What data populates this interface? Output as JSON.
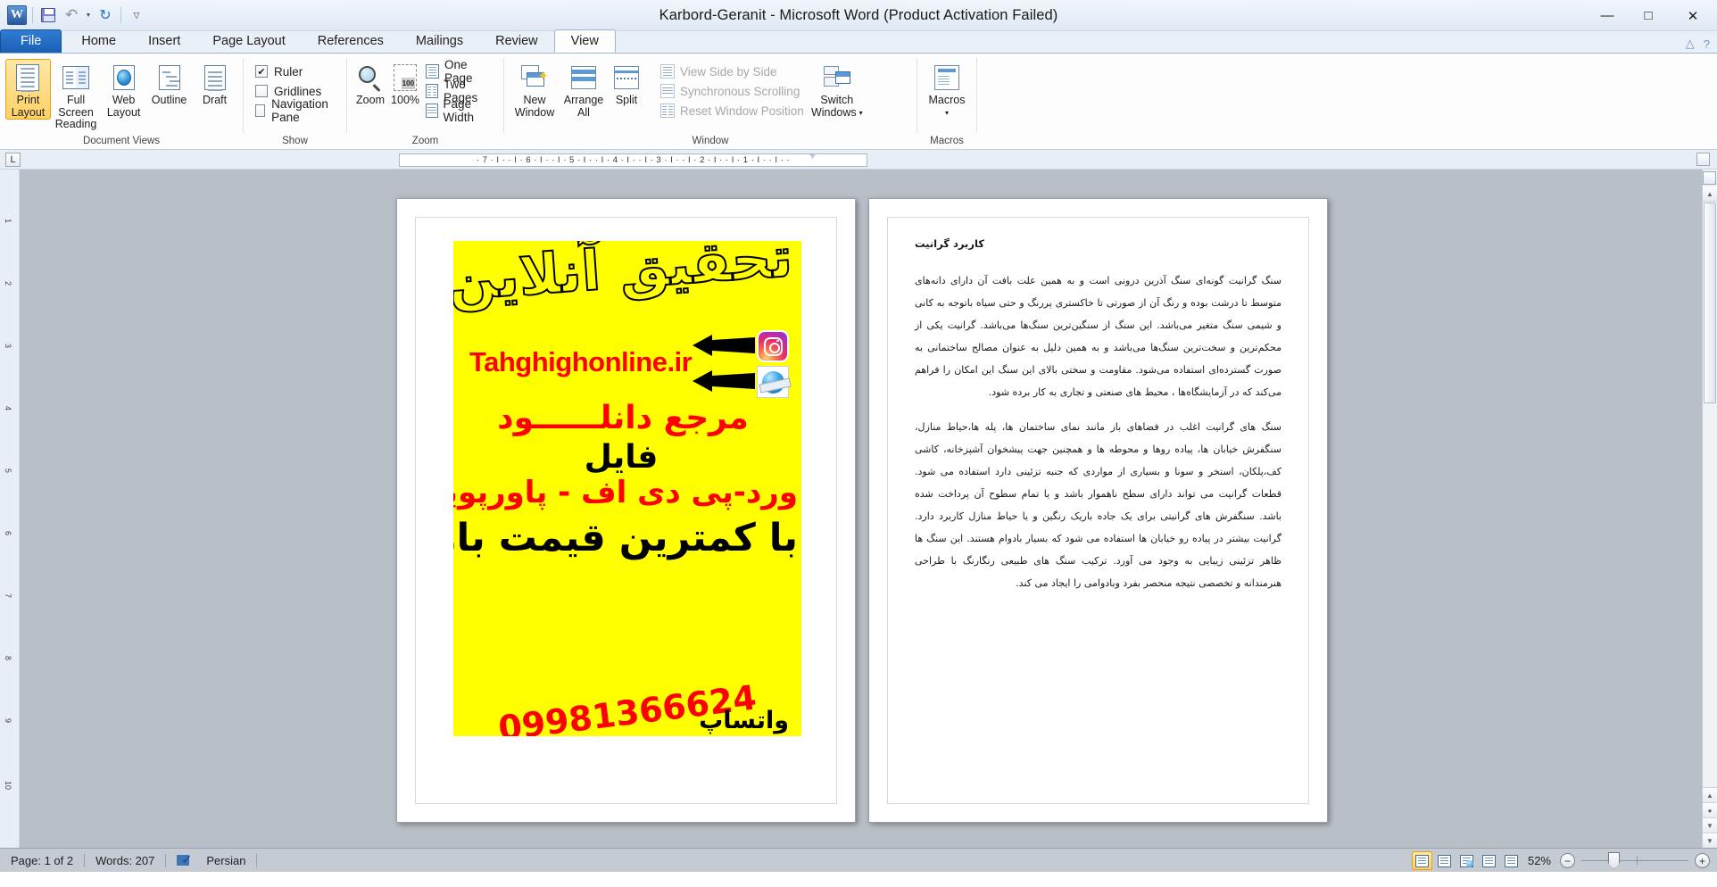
{
  "titlebar": {
    "title": "Karbord-Geranit  -  Microsoft Word (Product Activation Failed)",
    "word_logo": "W",
    "qat": [
      {
        "name": "save-icon",
        "label": "Save"
      },
      {
        "name": "undo-icon",
        "label": "Undo"
      },
      {
        "name": "redo-icon",
        "label": "Redo"
      },
      {
        "name": "customize-qat-icon",
        "label": "Customize Quick Access Toolbar"
      }
    ],
    "minimize": "—",
    "maximize": "□",
    "close": "✕"
  },
  "tabs": [
    {
      "label": "File",
      "active": false,
      "file": true
    },
    {
      "label": "Home",
      "active": false
    },
    {
      "label": "Insert",
      "active": false
    },
    {
      "label": "Page Layout",
      "active": false
    },
    {
      "label": "References",
      "active": false
    },
    {
      "label": "Mailings",
      "active": false
    },
    {
      "label": "Review",
      "active": false
    },
    {
      "label": "View",
      "active": true
    }
  ],
  "tab_help": {
    "minimize_ribbon": "△",
    "help": "?"
  },
  "ribbon": {
    "groups": [
      {
        "label": "Document Views",
        "buttons": [
          {
            "label_line1": "Print",
            "label_line2": "Layout",
            "icon": "print-layout-icon",
            "selected": true
          },
          {
            "label_line1": "Full Screen",
            "label_line2": "Reading",
            "icon": "full-screen-reading-icon",
            "selected": false
          },
          {
            "label_line1": "Web",
            "label_line2": "Layout",
            "icon": "web-layout-icon",
            "selected": false
          },
          {
            "label_line1": "Outline",
            "label_line2": "",
            "icon": "outline-icon",
            "selected": false
          },
          {
            "label_line1": "Draft",
            "label_line2": "",
            "icon": "draft-icon",
            "selected": false
          }
        ]
      },
      {
        "label": "Show",
        "checkboxes": [
          {
            "label": "Ruler",
            "checked": true,
            "mark": "✔"
          },
          {
            "label": "Gridlines",
            "checked": false,
            "mark": ""
          },
          {
            "label": "Navigation Pane",
            "checked": false,
            "mark": ""
          }
        ]
      },
      {
        "label": "Zoom",
        "buttons": [
          {
            "label_line1": "Zoom",
            "label_line2": "",
            "icon": "magnifier-icon"
          },
          {
            "label_line1": "100%",
            "label_line2": "",
            "icon": "zoom-100-icon",
            "badge": "100"
          }
        ],
        "small_buttons": [
          {
            "label": "One Page",
            "icon": "one-page-icon",
            "disabled": false
          },
          {
            "label": "Two Pages",
            "icon": "two-pages-icon",
            "disabled": false
          },
          {
            "label": "Page Width",
            "icon": "page-width-icon",
            "disabled": false
          }
        ]
      },
      {
        "label": "Window",
        "buttons": [
          {
            "label_line1": "New",
            "label_line2": "Window",
            "icon": "new-window-icon"
          },
          {
            "label_line1": "Arrange",
            "label_line2": "All",
            "icon": "arrange-all-icon"
          },
          {
            "label_line1": "Split",
            "label_line2": "",
            "icon": "split-icon"
          }
        ],
        "small_buttons": [
          {
            "label": "View Side by Side",
            "icon": "view-side-by-side-icon",
            "disabled": true
          },
          {
            "label": "Synchronous Scrolling",
            "icon": "synchronous-scrolling-icon",
            "disabled": true
          },
          {
            "label": "Reset Window Position",
            "icon": "reset-window-position-icon",
            "disabled": true
          }
        ],
        "switch_windows": {
          "label_line1": "Switch",
          "label_line2": "Windows",
          "icon": "switch-windows-icon",
          "arrow": "▾"
        }
      },
      {
        "label": "Macros",
        "buttons": [
          {
            "label_line1": "Macros",
            "label_line2": "",
            "icon": "macros-icon",
            "arrow": "▾"
          }
        ]
      }
    ]
  },
  "ruler": {
    "tab_selector": "L",
    "marks": "· 7 · I · · I · 6 · I · · I · 5 · I · · I · 4 · I · · I · 3 · I · · I · 2 · I · · I · 1 · I · · I · ·"
  },
  "vertical_ruler": {
    "marks": [
      "1",
      "2",
      "3",
      "4",
      "5",
      "6",
      "7",
      "8",
      "9",
      "10"
    ]
  },
  "document": {
    "page1": {
      "ad": {
        "headline": "تحقیق آنلاین",
        "url": "Tahghighonline.ir",
        "line_red1": "مرجع دانلــــــود",
        "line_black1": "فایل",
        "line_red2": "ورد-پی دی اف - پاورپوینت",
        "line_black2": "با کمترین قیمت بازار",
        "phone": "09981366624",
        "whatsapp": "واتساپ",
        "bg_color": "#ffff00",
        "accent_color": "#ff0000"
      }
    },
    "page2": {
      "heading": "کاربرد گرانیت",
      "paragraphs": [
        "سنگ گرانیت گونه‌ای سنگ آذرین درونی است و به همین علت بافت آن دارای دانه‌های متوسط تا درشت بوده و رنگ آن از صورتی تا خاکستری پررنگ و حتی سیاه باتوجه به کانی و شیمی سنگ متغیر می‌باشد. این سنگ از سنگین‌ترین سنگ‌ها می‌باشد. گرانیت یکی از محکم‌ترین و سخت‌ترین سنگ‌ها می‌باشد و به همین دلیل به عنوان مصالح ساختمانی به صورت گسترده‌ای استفاده می‌شود. مقاومت و سختی بالای این سنگ این امکان را فراهم می‌کند که در آزمایشگاه‌ها ، محیط های صنعتی و تجاری به کار برده شود.",
        "سنگ های گرانیت اغلب در فضاهای باز مانند نمای ساختمان ها، پله ها،حیاط منازل، سنگفرش خیابان ها، پیاده روها و محوطه ها و همچنین جهت پیشخوان آشپزخانه، کاشی کف،پلکان، استخر و سونا و بسیاری از مواردی که جنبه تزئینی دارد استفاده می شود. قطعات گرانیت می تواند دارای سطح ناهموار باشد و یا تمام سطوح آن پرداخت شده باشد. سنگفرش های گرانیتی برای یک جاده باریک رنگین و یا حیاط منازل کاربرد دارد. گرانیت بیشتر در پیاده رو خیابان ها استفاده می شود که بسیار بادوام هستند. این سنگ ها ظاهر تزئینی زیبایی به وجود می آورد. ترکیب سنگ های طبیعی رنگارنگ با طراحی هنرمندانه و تخصصی نتیجه منحصر بفرد وبادوامی را ایجاد می کند."
      ]
    }
  },
  "status_bar": {
    "page": "Page: 1 of 2",
    "words": "Words: 207",
    "language": "Persian",
    "proofing_icon": "spelling-and-grammar-check-icon",
    "view_buttons": [
      {
        "name": "print-layout-view-button",
        "selected": true
      },
      {
        "name": "full-screen-reading-view-button",
        "selected": false
      },
      {
        "name": "web-layout-view-button",
        "selected": false
      },
      {
        "name": "outline-view-button",
        "selected": false
      },
      {
        "name": "draft-view-button",
        "selected": false
      }
    ],
    "zoom_level": "52%",
    "zoom_out": "−",
    "zoom_in": "+"
  },
  "scrollbar": {
    "up_arrow": "▲",
    "down_arrow": "▼",
    "prev_page": "▲",
    "select_browse": "●",
    "next_page": "▼"
  }
}
